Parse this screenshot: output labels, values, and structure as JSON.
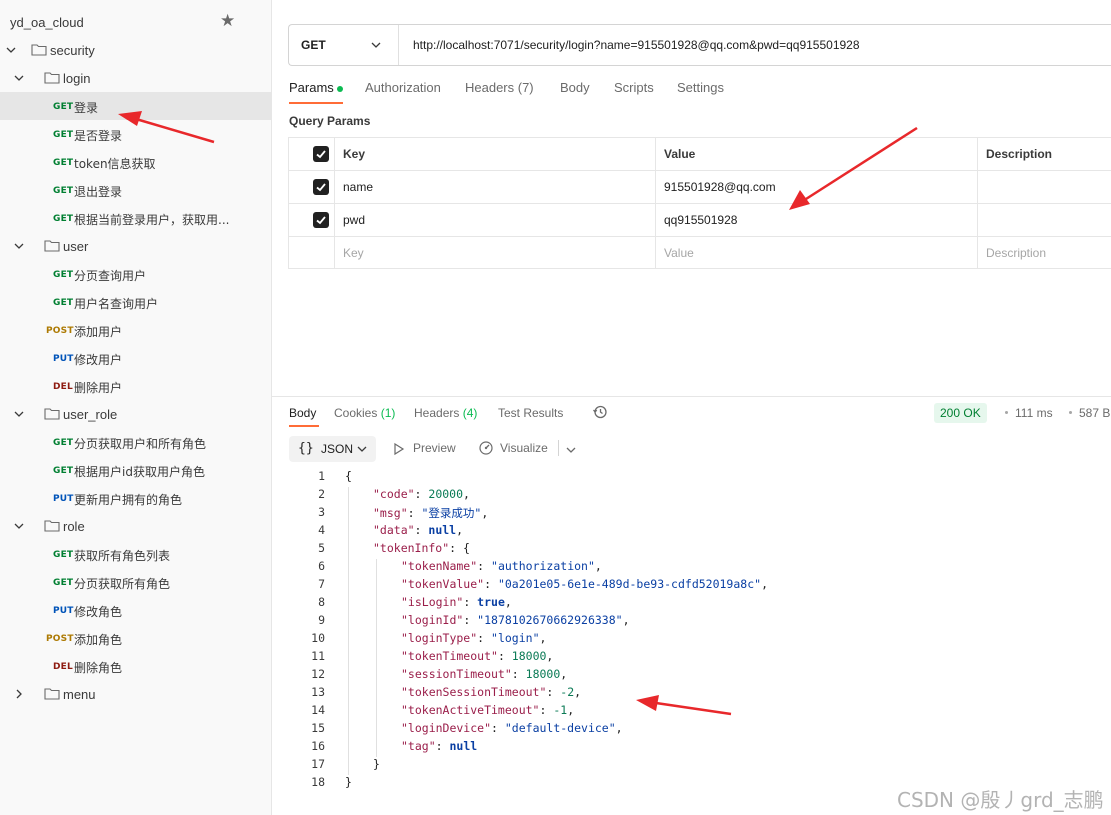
{
  "sidebar": {
    "collection_name": "yd_oa_cloud",
    "tree": [
      {
        "kind": "folder",
        "depth": 0,
        "expanded": true,
        "label": "security"
      },
      {
        "kind": "folder",
        "depth": 1,
        "expanded": true,
        "label": "login"
      },
      {
        "kind": "request",
        "depth": 2,
        "method": "GET",
        "label": "登录",
        "active": true
      },
      {
        "kind": "request",
        "depth": 2,
        "method": "GET",
        "label": "是否登录"
      },
      {
        "kind": "request",
        "depth": 2,
        "method": "GET",
        "label": "token信息获取"
      },
      {
        "kind": "request",
        "depth": 2,
        "method": "GET",
        "label": "退出登录"
      },
      {
        "kind": "request",
        "depth": 2,
        "method": "GET",
        "label": "根据当前登录用户，获取用..."
      },
      {
        "kind": "folder",
        "depth": 1,
        "expanded": true,
        "label": "user"
      },
      {
        "kind": "request",
        "depth": 2,
        "method": "GET",
        "label": "分页查询用户"
      },
      {
        "kind": "request",
        "depth": 2,
        "method": "GET",
        "label": "用户名查询用户"
      },
      {
        "kind": "request",
        "depth": 2,
        "method": "POST",
        "label": "添加用户"
      },
      {
        "kind": "request",
        "depth": 2,
        "method": "PUT",
        "label": "修改用户"
      },
      {
        "kind": "request",
        "depth": 2,
        "method": "DEL",
        "label": "删除用户"
      },
      {
        "kind": "folder",
        "depth": 1,
        "expanded": true,
        "label": "user_role"
      },
      {
        "kind": "request",
        "depth": 2,
        "method": "GET",
        "label": "分页获取用户和所有角色"
      },
      {
        "kind": "request",
        "depth": 2,
        "method": "GET",
        "label": "根据用户id获取用户角色"
      },
      {
        "kind": "request",
        "depth": 2,
        "method": "PUT",
        "label": "更新用户拥有的角色"
      },
      {
        "kind": "folder",
        "depth": 1,
        "expanded": true,
        "label": "role"
      },
      {
        "kind": "request",
        "depth": 2,
        "method": "GET",
        "label": "获取所有角色列表"
      },
      {
        "kind": "request",
        "depth": 2,
        "method": "GET",
        "label": "分页获取所有角色"
      },
      {
        "kind": "request",
        "depth": 2,
        "method": "PUT",
        "label": "修改角色"
      },
      {
        "kind": "request",
        "depth": 2,
        "method": "POST",
        "label": "添加角色"
      },
      {
        "kind": "request",
        "depth": 2,
        "method": "DEL",
        "label": "删除角色"
      },
      {
        "kind": "folder",
        "depth": 1,
        "expanded": false,
        "label": "menu"
      }
    ]
  },
  "request": {
    "method": "GET",
    "url": "http://localhost:7071/security/login?name=915501928@qq.com&pwd=qq915501928",
    "tabs": [
      {
        "label": "Params",
        "active": true,
        "dot": true
      },
      {
        "label": "Authorization"
      },
      {
        "label": "Headers (7)"
      },
      {
        "label": "Body"
      },
      {
        "label": "Scripts"
      },
      {
        "label": "Settings"
      }
    ],
    "query_params_title": "Query Params",
    "table_headers": {
      "key": "Key",
      "value": "Value",
      "description": "Description"
    },
    "params": [
      {
        "checked": true,
        "key": "name",
        "value": "915501928@qq.com",
        "description": ""
      },
      {
        "checked": true,
        "key": "pwd",
        "value": "qq915501928",
        "description": ""
      }
    ],
    "placeholder_row": {
      "key": "Key",
      "value": "Value",
      "description": "Description"
    }
  },
  "response": {
    "tabs": [
      {
        "label": "Body",
        "active": true
      },
      {
        "label": "Cookies",
        "count": "(1)"
      },
      {
        "label": "Headers",
        "count": "(4)"
      },
      {
        "label": "Test Results"
      }
    ],
    "status": "200 OK",
    "time": "111 ms",
    "size": "587 B",
    "format": "JSON",
    "preview_label": "Preview",
    "visualize_label": "Visualize",
    "body_lines": [
      {
        "n": "1",
        "indent": 0,
        "parts": [
          [
            "p",
            "{"
          ]
        ]
      },
      {
        "n": "2",
        "indent": 1,
        "parts": [
          [
            "k",
            "\"code\""
          ],
          [
            "p",
            ": "
          ],
          [
            "n",
            "20000"
          ],
          [
            "p",
            ","
          ]
        ]
      },
      {
        "n": "3",
        "indent": 1,
        "parts": [
          [
            "k",
            "\"msg\""
          ],
          [
            "p",
            ": "
          ],
          [
            "s",
            "\"登录成功\""
          ],
          [
            "p",
            ","
          ]
        ]
      },
      {
        "n": "4",
        "indent": 1,
        "parts": [
          [
            "k",
            "\"data\""
          ],
          [
            "p",
            ": "
          ],
          [
            "b",
            "null"
          ],
          [
            "p",
            ","
          ]
        ]
      },
      {
        "n": "5",
        "indent": 1,
        "parts": [
          [
            "k",
            "\"tokenInfo\""
          ],
          [
            "p",
            ": {"
          ]
        ]
      },
      {
        "n": "6",
        "indent": 2,
        "parts": [
          [
            "k",
            "\"tokenName\""
          ],
          [
            "p",
            ": "
          ],
          [
            "s",
            "\"authorization\""
          ],
          [
            "p",
            ","
          ]
        ]
      },
      {
        "n": "7",
        "indent": 2,
        "parts": [
          [
            "k",
            "\"tokenValue\""
          ],
          [
            "p",
            ": "
          ],
          [
            "s",
            "\"0a201e05-6e1e-489d-be93-cdfd52019a8c\""
          ],
          [
            "p",
            ","
          ]
        ]
      },
      {
        "n": "8",
        "indent": 2,
        "parts": [
          [
            "k",
            "\"isLogin\""
          ],
          [
            "p",
            ": "
          ],
          [
            "b",
            "true"
          ],
          [
            "p",
            ","
          ]
        ]
      },
      {
        "n": "9",
        "indent": 2,
        "parts": [
          [
            "k",
            "\"loginId\""
          ],
          [
            "p",
            ": "
          ],
          [
            "s",
            "\"1878102670662926338\""
          ],
          [
            "p",
            ","
          ]
        ]
      },
      {
        "n": "10",
        "indent": 2,
        "parts": [
          [
            "k",
            "\"loginType\""
          ],
          [
            "p",
            ": "
          ],
          [
            "s",
            "\"login\""
          ],
          [
            "p",
            ","
          ]
        ]
      },
      {
        "n": "11",
        "indent": 2,
        "parts": [
          [
            "k",
            "\"tokenTimeout\""
          ],
          [
            "p",
            ": "
          ],
          [
            "n",
            "18000"
          ],
          [
            "p",
            ","
          ]
        ]
      },
      {
        "n": "12",
        "indent": 2,
        "parts": [
          [
            "k",
            "\"sessionTimeout\""
          ],
          [
            "p",
            ": "
          ],
          [
            "n",
            "18000"
          ],
          [
            "p",
            ","
          ]
        ]
      },
      {
        "n": "13",
        "indent": 2,
        "parts": [
          [
            "k",
            "\"tokenSessionTimeout\""
          ],
          [
            "p",
            ": "
          ],
          [
            "n",
            "-2"
          ],
          [
            "p",
            ","
          ]
        ]
      },
      {
        "n": "14",
        "indent": 2,
        "parts": [
          [
            "k",
            "\"tokenActiveTimeout\""
          ],
          [
            "p",
            ": "
          ],
          [
            "n",
            "-1"
          ],
          [
            "p",
            ","
          ]
        ]
      },
      {
        "n": "15",
        "indent": 2,
        "parts": [
          [
            "k",
            "\"loginDevice\""
          ],
          [
            "p",
            ": "
          ],
          [
            "s",
            "\"default-device\""
          ],
          [
            "p",
            ","
          ]
        ]
      },
      {
        "n": "16",
        "indent": 2,
        "parts": [
          [
            "k",
            "\"tag\""
          ],
          [
            "p",
            ": "
          ],
          [
            "b",
            "null"
          ]
        ]
      },
      {
        "n": "17",
        "indent": 1,
        "parts": [
          [
            "p",
            "}"
          ]
        ]
      },
      {
        "n": "18",
        "indent": 0,
        "parts": [
          [
            "p",
            "}"
          ]
        ]
      }
    ]
  },
  "watermark": "CSDN @殷丿grd_志鹏",
  "colors": {
    "annotation_arrow": "#e8282b",
    "accent": "#ff6c37",
    "status_ok": "#007f31"
  }
}
